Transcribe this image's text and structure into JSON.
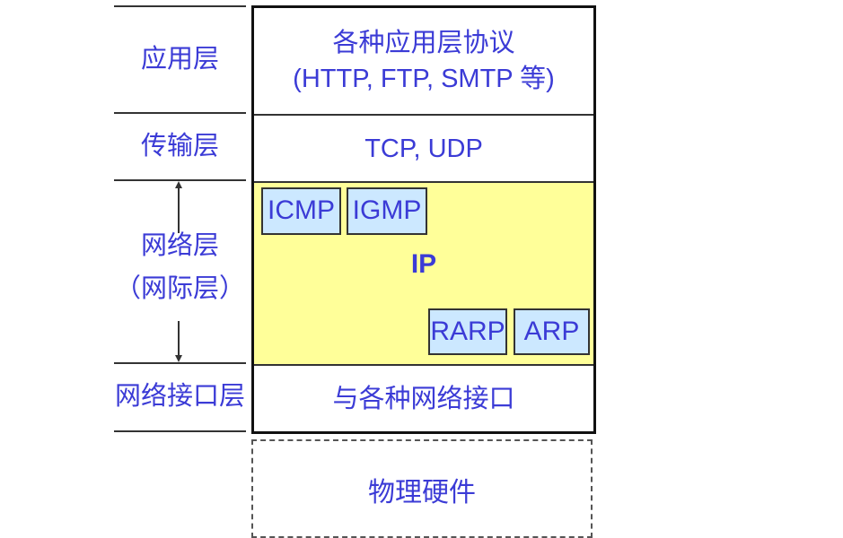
{
  "layers": {
    "application": "应用层",
    "transport": "传输层",
    "network": "网络层",
    "network_alt": "（网际层）",
    "interface": "网络接口层"
  },
  "stack": {
    "application_line1": "各种应用层协议",
    "application_line2": "(HTTP, FTP, SMTP 等)",
    "transport": "TCP, UDP",
    "network_core": "IP",
    "network_protocols": [
      "ICMP",
      "IGMP",
      "RARP",
      "ARP"
    ],
    "interface": "与各种网络接口",
    "hardware": "物理硬件"
  },
  "colors": {
    "text": "#3b3bd6",
    "network_fill": "#ffff99",
    "protocol_fill": "#cce8ff"
  }
}
